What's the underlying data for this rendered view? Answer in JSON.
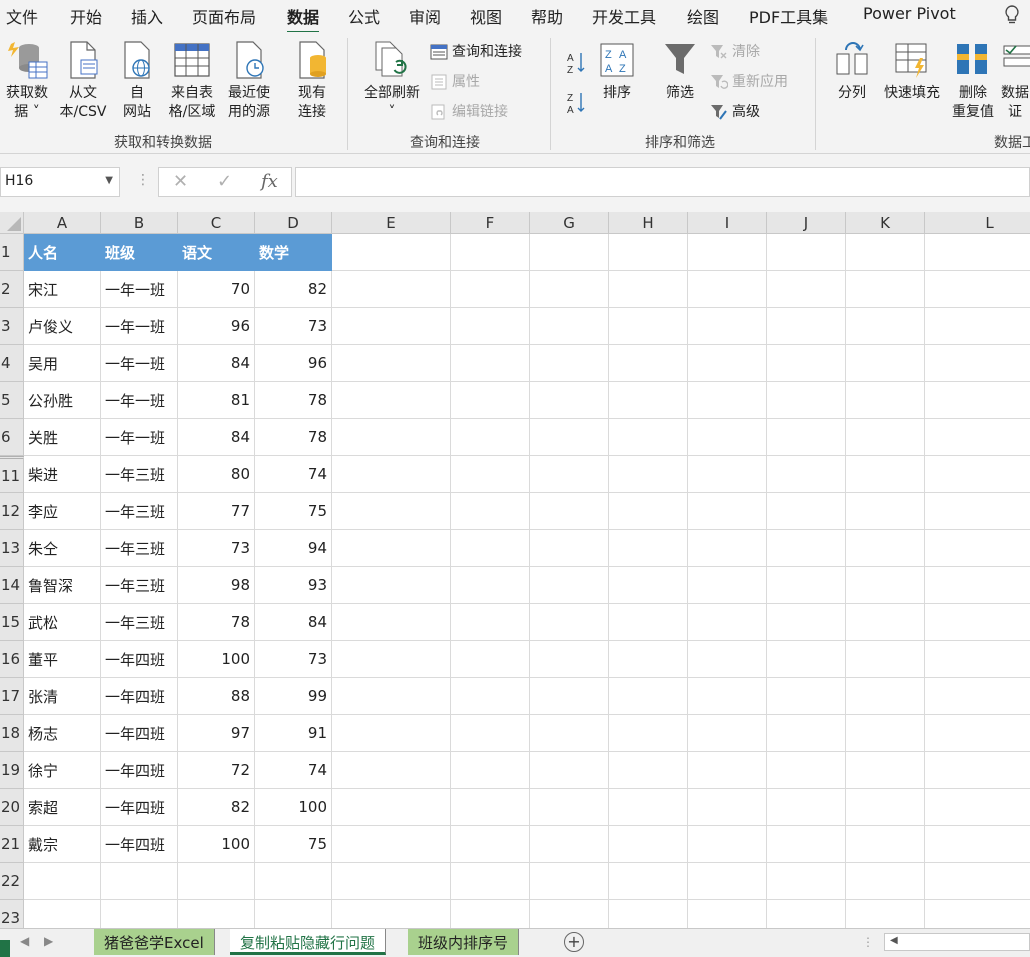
{
  "menu": {
    "tabs": [
      {
        "label": "文件"
      },
      {
        "label": "开始"
      },
      {
        "label": "插入"
      },
      {
        "label": "页面布局"
      },
      {
        "label": "数据"
      },
      {
        "label": "公式"
      },
      {
        "label": "审阅"
      },
      {
        "label": "视图"
      },
      {
        "label": "帮助"
      },
      {
        "label": "开发工具"
      },
      {
        "label": "绘图"
      },
      {
        "label": "PDF工具集"
      },
      {
        "label": "Power Pivot"
      }
    ],
    "active": "数据"
  },
  "ribbon": {
    "get_data": {
      "line1": "获取数",
      "line2": "据 ˅"
    },
    "from_csv": {
      "line1": "从文",
      "line2": "本/CSV"
    },
    "from_web": {
      "line1": "自",
      "line2": "网站"
    },
    "from_table": {
      "line1": "来自表",
      "line2": "格/区域"
    },
    "recent_sources": {
      "line1": "最近使",
      "line2": "用的源"
    },
    "existing_conn": {
      "line1": "现有",
      "line2": "连接"
    },
    "group_get_transform": "获取和转换数据",
    "refresh_all": {
      "line1": "全部刷新",
      "line2": "˅"
    },
    "queries_connections": "查询和连接",
    "properties": "属性",
    "edit_links": "编辑链接",
    "group_queries": "查询和连接",
    "sort": "排序",
    "filter": "筛选",
    "clear": "清除",
    "reapply": "重新应用",
    "advanced": "高级",
    "group_sort_filter": "排序和筛选",
    "text_to_columns": "分列",
    "flash_fill": "快速填充",
    "remove_dup": {
      "line1": "删除",
      "line2": "重复值"
    },
    "data_validation": {
      "line1": "数据",
      "line2": "证"
    },
    "group_data_tools": "数据工"
  },
  "formula_bar": {
    "name_box": "H16",
    "fx": "fx",
    "cancel": "✕",
    "enter": "✓",
    "content": ""
  },
  "grid": {
    "columns": [
      "A",
      "B",
      "C",
      "D",
      "E",
      "F",
      "G",
      "H",
      "I",
      "J",
      "K",
      "L"
    ],
    "header_row": {
      "row": "1",
      "cells": [
        "人名",
        "班级",
        "语文",
        "数学"
      ]
    },
    "rows": [
      {
        "row": "2",
        "name": "宋江",
        "class": "一年一班",
        "chinese": "70",
        "math": "82"
      },
      {
        "row": "3",
        "name": "卢俊义",
        "class": "一年一班",
        "chinese": "96",
        "math": "73"
      },
      {
        "row": "4",
        "name": "吴用",
        "class": "一年一班",
        "chinese": "84",
        "math": "96"
      },
      {
        "row": "5",
        "name": "公孙胜",
        "class": "一年一班",
        "chinese": "81",
        "math": "78"
      },
      {
        "row": "6",
        "name": "关胜",
        "class": "一年一班",
        "chinese": "84",
        "math": "78"
      },
      {
        "row": "11",
        "name": "柴进",
        "class": "一年三班",
        "chinese": "80",
        "math": "74"
      },
      {
        "row": "12",
        "name": "李应",
        "class": "一年三班",
        "chinese": "77",
        "math": "75"
      },
      {
        "row": "13",
        "name": "朱仝",
        "class": "一年三班",
        "chinese": "73",
        "math": "94"
      },
      {
        "row": "14",
        "name": "鲁智深",
        "class": "一年三班",
        "chinese": "98",
        "math": "93"
      },
      {
        "row": "15",
        "name": "武松",
        "class": "一年三班",
        "chinese": "78",
        "math": "84"
      },
      {
        "row": "16",
        "name": "董平",
        "class": "一年四班",
        "chinese": "100",
        "math": "73"
      },
      {
        "row": "17",
        "name": "张清",
        "class": "一年四班",
        "chinese": "88",
        "math": "99"
      },
      {
        "row": "18",
        "name": "杨志",
        "class": "一年四班",
        "chinese": "97",
        "math": "91"
      },
      {
        "row": "19",
        "name": "徐宁",
        "class": "一年四班",
        "chinese": "72",
        "math": "74"
      },
      {
        "row": "20",
        "name": "索超",
        "class": "一年四班",
        "chinese": "82",
        "math": "100"
      },
      {
        "row": "21",
        "name": "戴宗",
        "class": "一年四班",
        "chinese": "100",
        "math": "75"
      }
    ],
    "empty_rows": [
      "22",
      "23"
    ]
  },
  "sheets": {
    "tabs": [
      {
        "label": "猪爸爸学Excel"
      },
      {
        "label": "复制粘贴隐藏行问题"
      },
      {
        "label": "班级内排序号"
      }
    ],
    "active_index": 1,
    "add": "+"
  },
  "colors": {
    "accent": "#217346",
    "header_fill": "#5b9bd5",
    "tab_fill": "#a9d18e"
  }
}
